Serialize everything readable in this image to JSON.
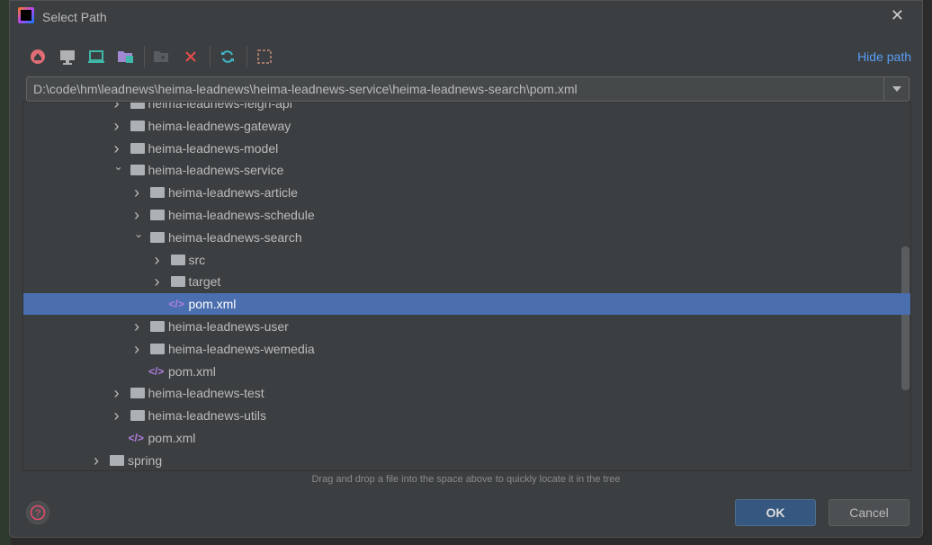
{
  "dialog": {
    "title": "Select Path",
    "hide_path": "Hide path",
    "path_value": "D:\\code\\hm\\leadnews\\heima-leadnews\\heima-leadnews-service\\heima-leadnews-search\\pom.xml",
    "hint": "Drag and drop a file into the space above to quickly locate it in the tree",
    "ok": "OK",
    "cancel": "Cancel"
  },
  "toolbar": [
    "home-icon",
    "desktop-icon",
    "project-icon",
    "module-icon",
    "new-folder-icon",
    "delete-icon",
    "refresh-icon",
    "show-hidden-icon"
  ],
  "tree": [
    {
      "label": "heima-leadnews-feign-api",
      "level": 1,
      "type": "folder",
      "expanded": false
    },
    {
      "label": "heima-leadnews-gateway",
      "level": 1,
      "type": "folder",
      "expanded": false
    },
    {
      "label": "heima-leadnews-model",
      "level": 1,
      "type": "folder",
      "expanded": false
    },
    {
      "label": "heima-leadnews-service",
      "level": 1,
      "type": "folder",
      "expanded": true
    },
    {
      "label": "heima-leadnews-article",
      "level": 2,
      "type": "folder",
      "expanded": false
    },
    {
      "label": "heima-leadnews-schedule",
      "level": 2,
      "type": "folder",
      "expanded": false
    },
    {
      "label": "heima-leadnews-search",
      "level": 2,
      "type": "folder",
      "expanded": true
    },
    {
      "label": "src",
      "level": 3,
      "type": "folder",
      "expanded": false
    },
    {
      "label": "target",
      "level": 3,
      "type": "folder",
      "expanded": false
    },
    {
      "label": "pom.xml",
      "level": 3,
      "type": "file",
      "selected": true
    },
    {
      "label": "heima-leadnews-user",
      "level": 2,
      "type": "folder",
      "expanded": false
    },
    {
      "label": "heima-leadnews-wemedia",
      "level": 2,
      "type": "folder",
      "expanded": false
    },
    {
      "label": "pom.xml",
      "level": 2,
      "type": "file"
    },
    {
      "label": "heima-leadnews-test",
      "level": 1,
      "type": "folder",
      "expanded": false
    },
    {
      "label": "heima-leadnews-utils",
      "level": 1,
      "type": "folder",
      "expanded": false
    },
    {
      "label": "pom.xml",
      "level": 1,
      "type": "file"
    },
    {
      "label": "spring",
      "level": 0,
      "type": "folder",
      "expanded": false
    }
  ]
}
